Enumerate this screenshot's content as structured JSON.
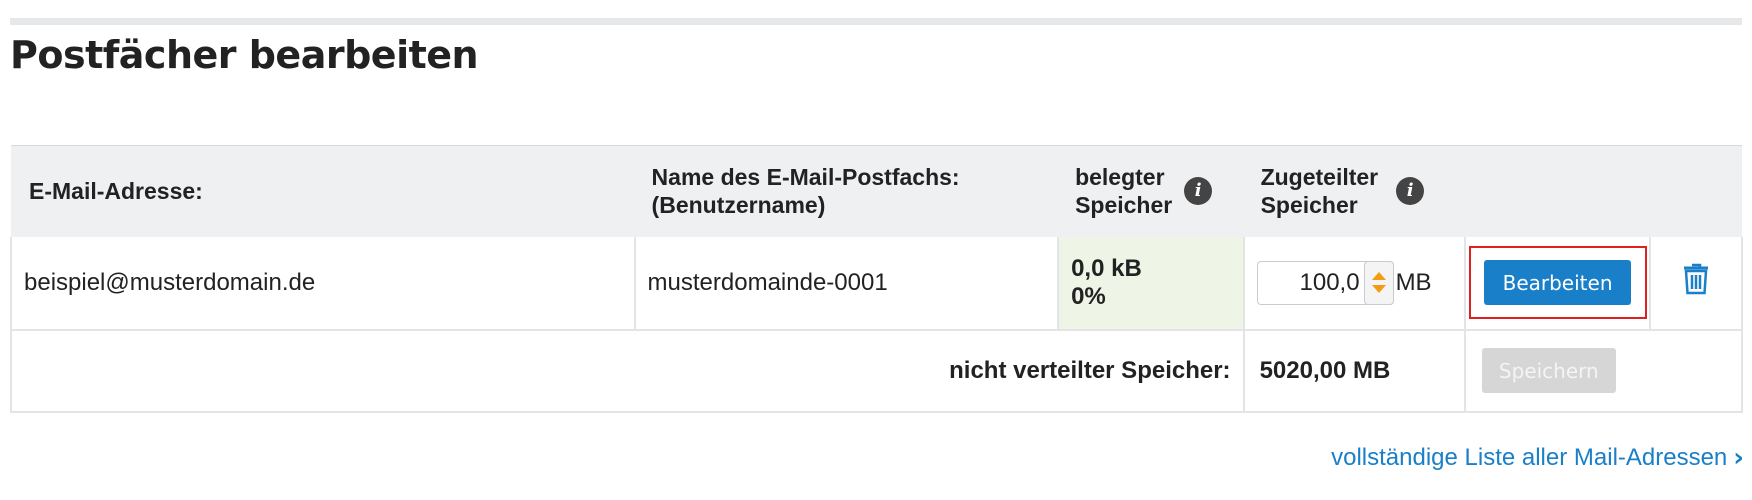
{
  "page": {
    "title": "Postfächer bearbeiten"
  },
  "table": {
    "headers": {
      "email": "E-Mail-Adresse:",
      "name_line1": "Name des E-Mail-Postfachs:",
      "name_line2": "(Benutzername)",
      "used_line1": "belegter",
      "used_line2": "Speicher",
      "allocated_line1": "Zugeteilter",
      "allocated_line2": "Speicher",
      "info_icon_glyph": "i"
    },
    "rows": [
      {
        "email": "beispiel@musterdomain.de",
        "username": "musterdomainde-0001",
        "used_size": "0,0 kB",
        "used_percent": "0%",
        "allocated_value": "100,0",
        "allocated_unit": "MB",
        "edit_label": "Bearbeiten",
        "delete_icon": "trash-icon"
      }
    ],
    "summary": {
      "label": "nicht verteilter Speicher:",
      "value": "5020,00 MB",
      "save_label": "Speichern"
    }
  },
  "footer": {
    "link_label": "vollständige Liste aller Mail-Adressen",
    "link_icon": "chevron-right-icon"
  },
  "colors": {
    "accent": "#1a7fc9",
    "used_text": "#6b9a1f",
    "used_bg": "#eef5e6",
    "highlight": "#e02020",
    "stepper_arrow": "#f39c12",
    "header_bg": "#eff0f1"
  }
}
